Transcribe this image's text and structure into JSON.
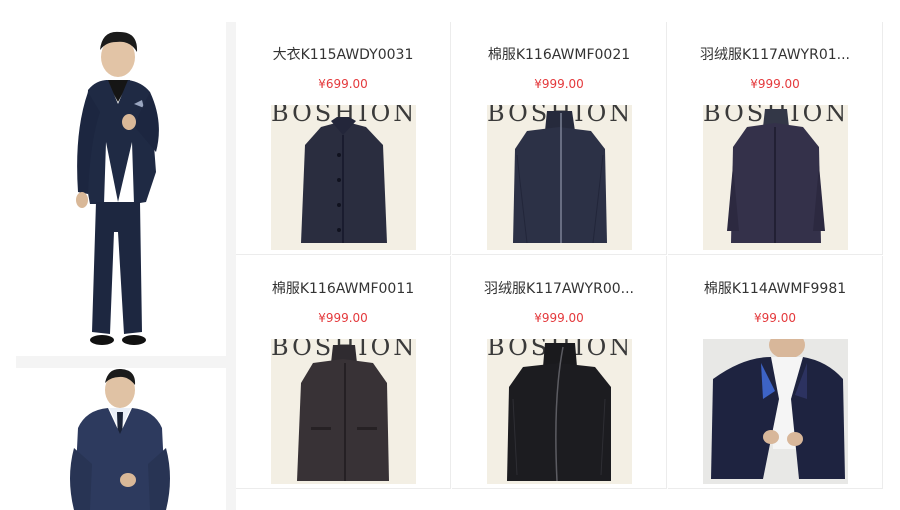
{
  "promos": [
    {
      "alt": "man in navy suit full body"
    },
    {
      "alt": "man in blue suit portrait"
    }
  ],
  "products": [
    {
      "title": "大衣K115AWDY0031",
      "price": "¥699.00",
      "brand_text": "BOSHION",
      "garment": "coat-buttoned"
    },
    {
      "title": "棉服K116AWMF0021",
      "price": "¥999.00",
      "brand_text": "BOSHION",
      "garment": "zip-jacket"
    },
    {
      "title": "羽绒服K117AWYR01...",
      "price": "¥999.00",
      "brand_text": "BOSHION",
      "garment": "down-coat-long"
    },
    {
      "title": "棉服K116AWMF0011",
      "price": "¥999.00",
      "brand_text": "BOSHION",
      "garment": "coat-long-dark"
    },
    {
      "title": "羽绒服K117AWYR00...",
      "price": "¥999.00",
      "brand_text": "BOSHION",
      "garment": "down-jacket-black"
    },
    {
      "title": "棉服K114AWMF9981",
      "price": "¥99.00",
      "brand_text": "",
      "garment": "jacket-worn"
    }
  ],
  "colors": {
    "price": "#e4393c",
    "suit_navy": "#1f2a44",
    "backdrop": "#f3efe4"
  }
}
